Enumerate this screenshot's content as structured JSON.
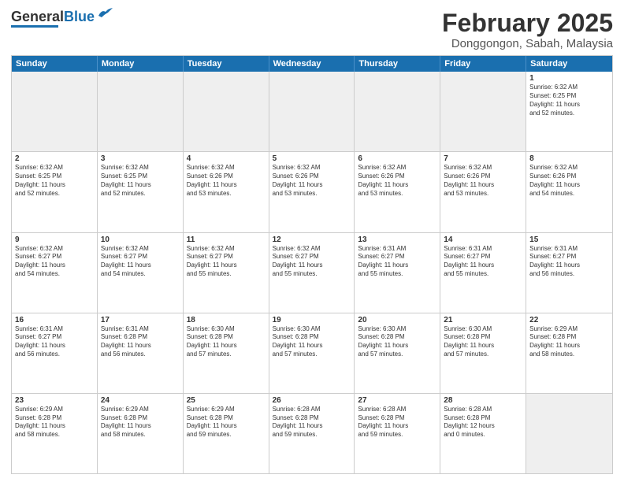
{
  "header": {
    "logo_general": "General",
    "logo_blue": "Blue",
    "title": "February 2025",
    "location": "Donggongon, Sabah, Malaysia"
  },
  "calendar": {
    "days_of_week": [
      "Sunday",
      "Monday",
      "Tuesday",
      "Wednesday",
      "Thursday",
      "Friday",
      "Saturday"
    ],
    "rows": [
      [
        {
          "day": "",
          "info": ""
        },
        {
          "day": "",
          "info": ""
        },
        {
          "day": "",
          "info": ""
        },
        {
          "day": "",
          "info": ""
        },
        {
          "day": "",
          "info": ""
        },
        {
          "day": "",
          "info": ""
        },
        {
          "day": "1",
          "info": "Sunrise: 6:32 AM\nSunset: 6:25 PM\nDaylight: 11 hours\nand 52 minutes."
        }
      ],
      [
        {
          "day": "2",
          "info": "Sunrise: 6:32 AM\nSunset: 6:25 PM\nDaylight: 11 hours\nand 52 minutes."
        },
        {
          "day": "3",
          "info": "Sunrise: 6:32 AM\nSunset: 6:25 PM\nDaylight: 11 hours\nand 52 minutes."
        },
        {
          "day": "4",
          "info": "Sunrise: 6:32 AM\nSunset: 6:26 PM\nDaylight: 11 hours\nand 53 minutes."
        },
        {
          "day": "5",
          "info": "Sunrise: 6:32 AM\nSunset: 6:26 PM\nDaylight: 11 hours\nand 53 minutes."
        },
        {
          "day": "6",
          "info": "Sunrise: 6:32 AM\nSunset: 6:26 PM\nDaylight: 11 hours\nand 53 minutes."
        },
        {
          "day": "7",
          "info": "Sunrise: 6:32 AM\nSunset: 6:26 PM\nDaylight: 11 hours\nand 53 minutes."
        },
        {
          "day": "8",
          "info": "Sunrise: 6:32 AM\nSunset: 6:26 PM\nDaylight: 11 hours\nand 54 minutes."
        }
      ],
      [
        {
          "day": "9",
          "info": "Sunrise: 6:32 AM\nSunset: 6:27 PM\nDaylight: 11 hours\nand 54 minutes."
        },
        {
          "day": "10",
          "info": "Sunrise: 6:32 AM\nSunset: 6:27 PM\nDaylight: 11 hours\nand 54 minutes."
        },
        {
          "day": "11",
          "info": "Sunrise: 6:32 AM\nSunset: 6:27 PM\nDaylight: 11 hours\nand 55 minutes."
        },
        {
          "day": "12",
          "info": "Sunrise: 6:32 AM\nSunset: 6:27 PM\nDaylight: 11 hours\nand 55 minutes."
        },
        {
          "day": "13",
          "info": "Sunrise: 6:31 AM\nSunset: 6:27 PM\nDaylight: 11 hours\nand 55 minutes."
        },
        {
          "day": "14",
          "info": "Sunrise: 6:31 AM\nSunset: 6:27 PM\nDaylight: 11 hours\nand 55 minutes."
        },
        {
          "day": "15",
          "info": "Sunrise: 6:31 AM\nSunset: 6:27 PM\nDaylight: 11 hours\nand 56 minutes."
        }
      ],
      [
        {
          "day": "16",
          "info": "Sunrise: 6:31 AM\nSunset: 6:27 PM\nDaylight: 11 hours\nand 56 minutes."
        },
        {
          "day": "17",
          "info": "Sunrise: 6:31 AM\nSunset: 6:28 PM\nDaylight: 11 hours\nand 56 minutes."
        },
        {
          "day": "18",
          "info": "Sunrise: 6:30 AM\nSunset: 6:28 PM\nDaylight: 11 hours\nand 57 minutes."
        },
        {
          "day": "19",
          "info": "Sunrise: 6:30 AM\nSunset: 6:28 PM\nDaylight: 11 hours\nand 57 minutes."
        },
        {
          "day": "20",
          "info": "Sunrise: 6:30 AM\nSunset: 6:28 PM\nDaylight: 11 hours\nand 57 minutes."
        },
        {
          "day": "21",
          "info": "Sunrise: 6:30 AM\nSunset: 6:28 PM\nDaylight: 11 hours\nand 57 minutes."
        },
        {
          "day": "22",
          "info": "Sunrise: 6:29 AM\nSunset: 6:28 PM\nDaylight: 11 hours\nand 58 minutes."
        }
      ],
      [
        {
          "day": "23",
          "info": "Sunrise: 6:29 AM\nSunset: 6:28 PM\nDaylight: 11 hours\nand 58 minutes."
        },
        {
          "day": "24",
          "info": "Sunrise: 6:29 AM\nSunset: 6:28 PM\nDaylight: 11 hours\nand 58 minutes."
        },
        {
          "day": "25",
          "info": "Sunrise: 6:29 AM\nSunset: 6:28 PM\nDaylight: 11 hours\nand 59 minutes."
        },
        {
          "day": "26",
          "info": "Sunrise: 6:28 AM\nSunset: 6:28 PM\nDaylight: 11 hours\nand 59 minutes."
        },
        {
          "day": "27",
          "info": "Sunrise: 6:28 AM\nSunset: 6:28 PM\nDaylight: 11 hours\nand 59 minutes."
        },
        {
          "day": "28",
          "info": "Sunrise: 6:28 AM\nSunset: 6:28 PM\nDaylight: 12 hours\nand 0 minutes."
        },
        {
          "day": "",
          "info": ""
        }
      ]
    ]
  }
}
